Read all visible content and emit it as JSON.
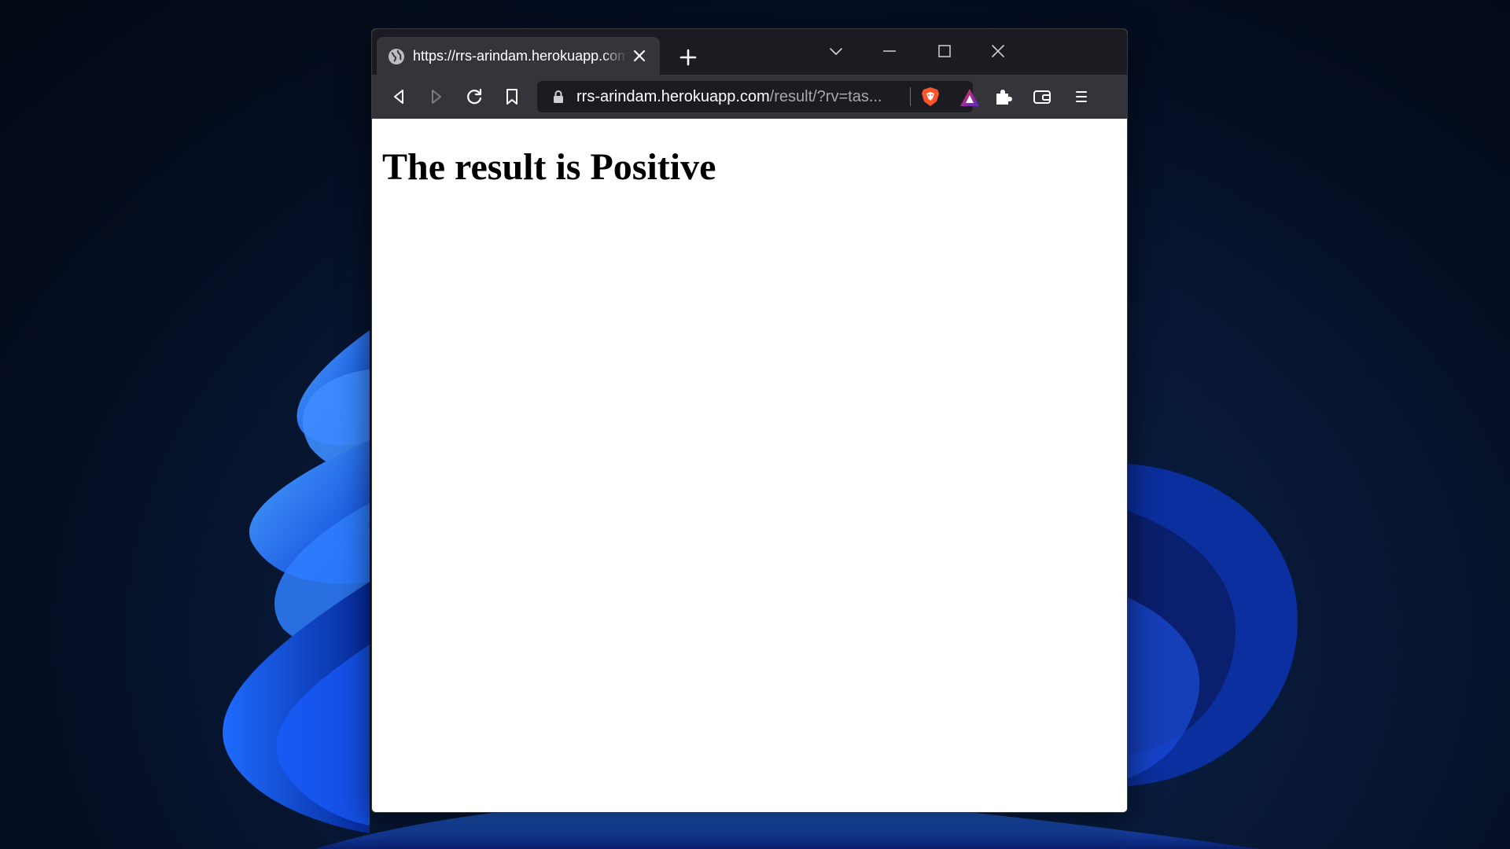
{
  "browser": {
    "tab": {
      "title": "https://rrs-arindam.herokuapp.com/result/?rv=tas...",
      "favicon": "globe-icon"
    },
    "window_controls": [
      "chevron-down-icon",
      "minimize-icon",
      "maximize-icon",
      "close-icon"
    ],
    "toolbar": {
      "buttons": [
        "back-icon",
        "forward-icon",
        "reload-icon",
        "bookmark-icon"
      ],
      "right_buttons": [
        "extensions-icon",
        "wallet-icon",
        "menu-icon"
      ]
    },
    "address_bar": {
      "host": "rrs-arindam.herokuapp.com",
      "path": "/result/?rv=tas..."
    }
  },
  "page": {
    "heading": "The result is Positive"
  },
  "colors": {
    "titlebar": "#1c1b22",
    "toolbar": "#35343b",
    "brave_orange": "#fb542b",
    "page_background": "#ffffff"
  }
}
